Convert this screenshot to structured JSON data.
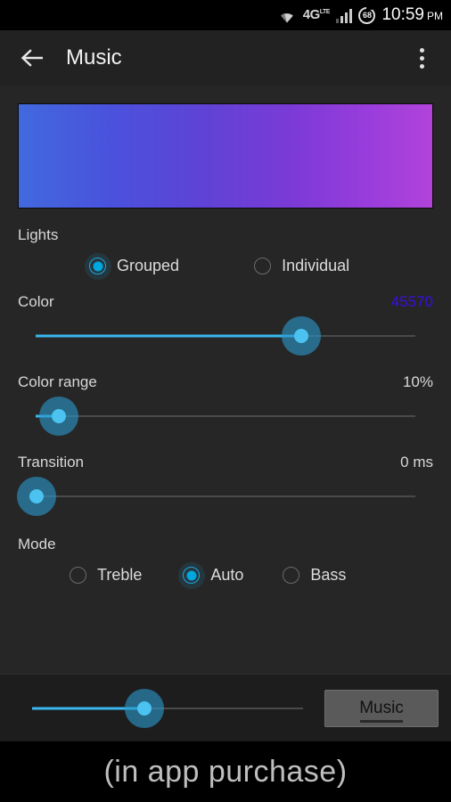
{
  "statusbar": {
    "wifi_icon": "wifi-icon",
    "network_label": "4G",
    "network_sup": "LTE",
    "signal_icon": "signal-bars-icon",
    "battery_percent": "68",
    "time": "10:59",
    "meridiem": "PM"
  },
  "actionbar": {
    "back_icon": "back-arrow-icon",
    "title": "Music",
    "overflow_icon": "overflow-menu-icon"
  },
  "preview": {
    "name": "color-gradient-preview",
    "gradient_start": "#4169dd",
    "gradient_mid": "#6b3fda",
    "gradient_end": "#b143d9"
  },
  "lights": {
    "label": "Lights",
    "options": [
      {
        "label": "Grouped",
        "selected": true
      },
      {
        "label": "Individual",
        "selected": false
      }
    ]
  },
  "color": {
    "label": "Color",
    "value": "45570",
    "value_color": "#3a0de8",
    "slider_percent": 70
  },
  "color_range": {
    "label": "Color range",
    "value": "10%",
    "slider_percent": 10
  },
  "transition": {
    "label": "Transition",
    "value": "0 ms",
    "slider_percent": 0
  },
  "mode": {
    "label": "Mode",
    "options": [
      {
        "label": "Treble",
        "selected": false
      },
      {
        "label": "Auto",
        "selected": true
      },
      {
        "label": "Bass",
        "selected": false
      }
    ]
  },
  "bottom": {
    "slider_percent": 33,
    "button_label": "Music"
  },
  "caption": {
    "text": "(in app purchase)"
  },
  "theme": {
    "accent": "#3ab7ee",
    "background": "#262626",
    "actionbar_bg": "#222222"
  }
}
